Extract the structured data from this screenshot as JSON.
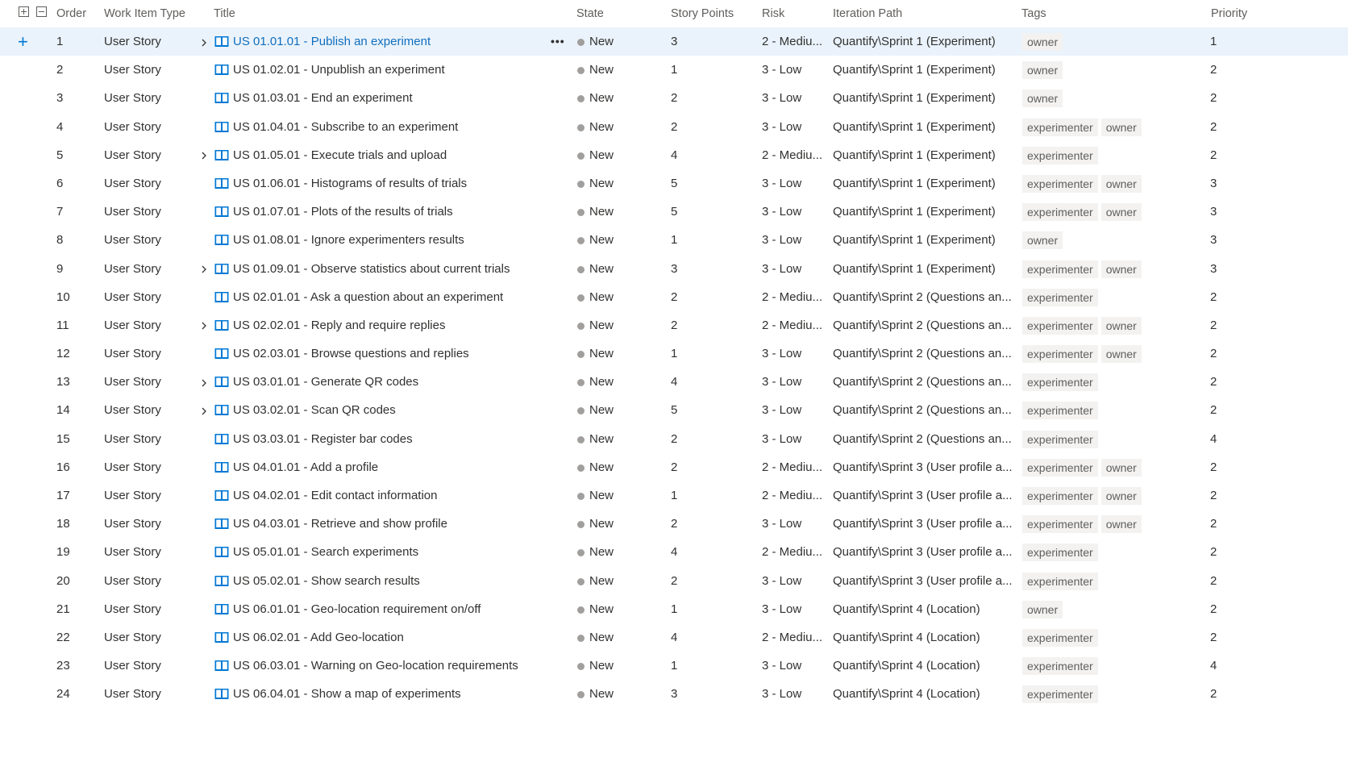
{
  "grid": {
    "headers": {
      "order": "Order",
      "work_item_type": "Work Item Type",
      "title": "Title",
      "state": "State",
      "story_points": "Story Points",
      "risk": "Risk",
      "iteration_path": "Iteration Path",
      "tags": "Tags",
      "priority": "Priority"
    },
    "colors": {
      "accent": "#0078d4",
      "selected_row_bg": "#eaf3fb",
      "state_dot_new": "#a19f9d",
      "tag_bg": "#f3f2f1",
      "story_icon": "#0078d4"
    },
    "selected_row_index": 0,
    "row_more_label": "•••",
    "add_label": "+",
    "rows": [
      {
        "order": "1",
        "type": "User Story",
        "expandable": true,
        "title": "US 01.01.01 - Publish an experiment",
        "state": "New",
        "points": "3",
        "risk": "2 - Mediu...",
        "iteration": "Quantify\\Sprint 1 (Experiment)",
        "tags": [
          "owner"
        ],
        "priority": "1"
      },
      {
        "order": "2",
        "type": "User Story",
        "expandable": false,
        "title": "US 01.02.01 - Unpublish an experiment",
        "state": "New",
        "points": "1",
        "risk": "3 - Low",
        "iteration": "Quantify\\Sprint 1 (Experiment)",
        "tags": [
          "owner"
        ],
        "priority": "2"
      },
      {
        "order": "3",
        "type": "User Story",
        "expandable": false,
        "title": "US 01.03.01 - End an experiment",
        "state": "New",
        "points": "2",
        "risk": "3 - Low",
        "iteration": "Quantify\\Sprint 1 (Experiment)",
        "tags": [
          "owner"
        ],
        "priority": "2"
      },
      {
        "order": "4",
        "type": "User Story",
        "expandable": false,
        "title": "US 01.04.01 - Subscribe to an experiment",
        "state": "New",
        "points": "2",
        "risk": "3 - Low",
        "iteration": "Quantify\\Sprint 1 (Experiment)",
        "tags": [
          "experimenter",
          "owner"
        ],
        "priority": "2"
      },
      {
        "order": "5",
        "type": "User Story",
        "expandable": true,
        "title": "US 01.05.01 - Execute trials and upload",
        "state": "New",
        "points": "4",
        "risk": "2 - Mediu...",
        "iteration": "Quantify\\Sprint 1 (Experiment)",
        "tags": [
          "experimenter"
        ],
        "priority": "2"
      },
      {
        "order": "6",
        "type": "User Story",
        "expandable": false,
        "title": "US 01.06.01 - Histograms of results of trials",
        "state": "New",
        "points": "5",
        "risk": "3 - Low",
        "iteration": "Quantify\\Sprint 1 (Experiment)",
        "tags": [
          "experimenter",
          "owner"
        ],
        "priority": "3"
      },
      {
        "order": "7",
        "type": "User Story",
        "expandable": false,
        "title": "US 01.07.01 - Plots of the results of trials",
        "state": "New",
        "points": "5",
        "risk": "3 - Low",
        "iteration": "Quantify\\Sprint 1 (Experiment)",
        "tags": [
          "experimenter",
          "owner"
        ],
        "priority": "3"
      },
      {
        "order": "8",
        "type": "User Story",
        "expandable": false,
        "title": "US 01.08.01 - Ignore experimenters results",
        "state": "New",
        "points": "1",
        "risk": "3 - Low",
        "iteration": "Quantify\\Sprint 1 (Experiment)",
        "tags": [
          "owner"
        ],
        "priority": "3"
      },
      {
        "order": "9",
        "type": "User Story",
        "expandable": true,
        "title": "US 01.09.01 - Observe statistics about current trials",
        "state": "New",
        "points": "3",
        "risk": "3 - Low",
        "iteration": "Quantify\\Sprint 1 (Experiment)",
        "tags": [
          "experimenter",
          "owner"
        ],
        "priority": "3"
      },
      {
        "order": "10",
        "type": "User Story",
        "expandable": false,
        "title": "US 02.01.01 - Ask a question about an experiment",
        "state": "New",
        "points": "2",
        "risk": "2 - Mediu...",
        "iteration": "Quantify\\Sprint 2 (Questions an...",
        "tags": [
          "experimenter"
        ],
        "priority": "2"
      },
      {
        "order": "11",
        "type": "User Story",
        "expandable": true,
        "title": "US 02.02.01 - Reply and require replies",
        "state": "New",
        "points": "2",
        "risk": "2 - Mediu...",
        "iteration": "Quantify\\Sprint 2 (Questions an...",
        "tags": [
          "experimenter",
          "owner"
        ],
        "priority": "2"
      },
      {
        "order": "12",
        "type": "User Story",
        "expandable": false,
        "title": "US 02.03.01 - Browse questions and replies",
        "state": "New",
        "points": "1",
        "risk": "3 - Low",
        "iteration": "Quantify\\Sprint 2 (Questions an...",
        "tags": [
          "experimenter",
          "owner"
        ],
        "priority": "2"
      },
      {
        "order": "13",
        "type": "User Story",
        "expandable": true,
        "title": "US 03.01.01 - Generate QR codes",
        "state": "New",
        "points": "4",
        "risk": "3 - Low",
        "iteration": "Quantify\\Sprint 2 (Questions an...",
        "tags": [
          "experimenter"
        ],
        "priority": "2"
      },
      {
        "order": "14",
        "type": "User Story",
        "expandable": true,
        "title": "US 03.02.01 - Scan QR codes",
        "state": "New",
        "points": "5",
        "risk": "3 - Low",
        "iteration": "Quantify\\Sprint 2 (Questions an...",
        "tags": [
          "experimenter"
        ],
        "priority": "2"
      },
      {
        "order": "15",
        "type": "User Story",
        "expandable": false,
        "title": "US 03.03.01 - Register bar codes",
        "state": "New",
        "points": "2",
        "risk": "3 - Low",
        "iteration": "Quantify\\Sprint 2 (Questions an...",
        "tags": [
          "experimenter"
        ],
        "priority": "4"
      },
      {
        "order": "16",
        "type": "User Story",
        "expandable": false,
        "title": "US 04.01.01 - Add a profile",
        "state": "New",
        "points": "2",
        "risk": "2 - Mediu...",
        "iteration": "Quantify\\Sprint 3 (User profile a...",
        "tags": [
          "experimenter",
          "owner"
        ],
        "priority": "2"
      },
      {
        "order": "17",
        "type": "User Story",
        "expandable": false,
        "title": "US 04.02.01 - Edit contact information",
        "state": "New",
        "points": "1",
        "risk": "2 - Mediu...",
        "iteration": "Quantify\\Sprint 3 (User profile a...",
        "tags": [
          "experimenter",
          "owner"
        ],
        "priority": "2"
      },
      {
        "order": "18",
        "type": "User Story",
        "expandable": false,
        "title": "US 04.03.01 - Retrieve and show profile",
        "state": "New",
        "points": "2",
        "risk": "3 - Low",
        "iteration": "Quantify\\Sprint 3 (User profile a...",
        "tags": [
          "experimenter",
          "owner"
        ],
        "priority": "2"
      },
      {
        "order": "19",
        "type": "User Story",
        "expandable": false,
        "title": "US 05.01.01 - Search experiments",
        "state": "New",
        "points": "4",
        "risk": "2 - Mediu...",
        "iteration": "Quantify\\Sprint 3 (User profile a...",
        "tags": [
          "experimenter"
        ],
        "priority": "2"
      },
      {
        "order": "20",
        "type": "User Story",
        "expandable": false,
        "title": "US 05.02.01 - Show search results",
        "state": "New",
        "points": "2",
        "risk": "3 - Low",
        "iteration": "Quantify\\Sprint 3 (User profile a...",
        "tags": [
          "experimenter"
        ],
        "priority": "2"
      },
      {
        "order": "21",
        "type": "User Story",
        "expandable": false,
        "title": "US 06.01.01 - Geo-location requirement on/off",
        "state": "New",
        "points": "1",
        "risk": "3 - Low",
        "iteration": "Quantify\\Sprint 4 (Location)",
        "tags": [
          "owner"
        ],
        "priority": "2"
      },
      {
        "order": "22",
        "type": "User Story",
        "expandable": false,
        "title": "US 06.02.01 - Add Geo-location",
        "state": "New",
        "points": "4",
        "risk": "2 - Mediu...",
        "iteration": "Quantify\\Sprint 4 (Location)",
        "tags": [
          "experimenter"
        ],
        "priority": "2"
      },
      {
        "order": "23",
        "type": "User Story",
        "expandable": false,
        "title": "US 06.03.01 - Warning on Geo-location requirements",
        "state": "New",
        "points": "1",
        "risk": "3 - Low",
        "iteration": "Quantify\\Sprint 4 (Location)",
        "tags": [
          "experimenter"
        ],
        "priority": "4"
      },
      {
        "order": "24",
        "type": "User Story",
        "expandable": false,
        "title": "US 06.04.01 - Show a map of experiments",
        "state": "New",
        "points": "3",
        "risk": "3 - Low",
        "iteration": "Quantify\\Sprint 4 (Location)",
        "tags": [
          "experimenter"
        ],
        "priority": "2"
      }
    ]
  }
}
